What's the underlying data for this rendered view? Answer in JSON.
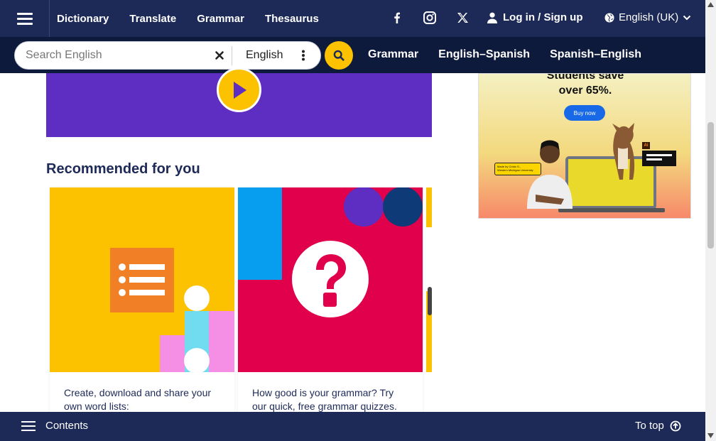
{
  "topnav": {
    "menu_icon": "hamburger-icon",
    "links": [
      "Dictionary",
      "Translate",
      "Grammar",
      "Thesaurus"
    ],
    "social_icons": [
      "facebook-icon",
      "instagram-icon",
      "x-icon"
    ],
    "login_label": "Log in / Sign up",
    "language_label": "English (UK)"
  },
  "search": {
    "placeholder": "Search English",
    "dictionary": "English",
    "links": [
      "Grammar",
      "English–Spanish",
      "Spanish–English"
    ]
  },
  "main": {
    "recommended_title": "Recommended for you",
    "cards": [
      {
        "text": "Create, download and share your own word lists:"
      },
      {
        "text": "How good is your grammar? Try our quick, free grammar quizzes."
      }
    ]
  },
  "ad": {
    "headline_1": "Students save",
    "headline_2": "over 65%.",
    "button": "Buy now",
    "tag_line_1": "Made by Cristo S.,",
    "tag_line_2": "Western Michigan University",
    "app_badge": "Ai"
  },
  "bottombar": {
    "contents_label": "Contents",
    "totop_label": "To top"
  },
  "colors": {
    "nav_bg": "#1d2a57",
    "search_bg": "#0e1a3c",
    "accent_yellow": "#fcc200",
    "video_purple": "#5e2ec2"
  }
}
